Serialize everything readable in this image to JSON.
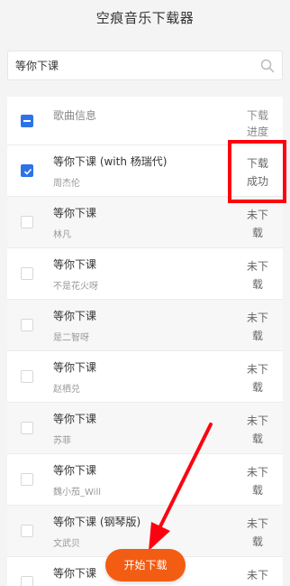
{
  "app": {
    "title": "空痕音乐下载器"
  },
  "search": {
    "value": "等你下课"
  },
  "table": {
    "header": {
      "col_song": "歌曲信息",
      "col_progress": "下载进度"
    },
    "rows": [
      {
        "title": "等你下课 (with 杨瑞代)",
        "artist": "周杰伦",
        "status": "下载成功",
        "checked": true
      },
      {
        "title": "等你下课",
        "artist": "林凡",
        "status": "未下载",
        "checked": false
      },
      {
        "title": "等你下课",
        "artist": "不是花火呀",
        "status": "未下载",
        "checked": false
      },
      {
        "title": "等你下课",
        "artist": "是二智呀",
        "status": "未下载",
        "checked": false
      },
      {
        "title": "等你下课",
        "artist": "赵栖兑",
        "status": "未下载",
        "checked": false
      },
      {
        "title": "等你下课",
        "artist": "苏菲",
        "status": "未下载",
        "checked": false
      },
      {
        "title": "等你下课",
        "artist": "魏小茄_Will",
        "status": "未下载",
        "checked": false
      },
      {
        "title": "等你下课 (钢琴版)",
        "artist": "文武贝",
        "status": "未下载",
        "checked": false
      },
      {
        "title": "等你下课",
        "artist": "",
        "status": "未下载",
        "checked": false
      }
    ]
  },
  "actions": {
    "start_label": "开始下载"
  },
  "colors": {
    "accent": "#2d73e8",
    "start_button": "#f25c13",
    "annotation": "#ff0010"
  },
  "icons": {
    "search": "search-icon"
  }
}
